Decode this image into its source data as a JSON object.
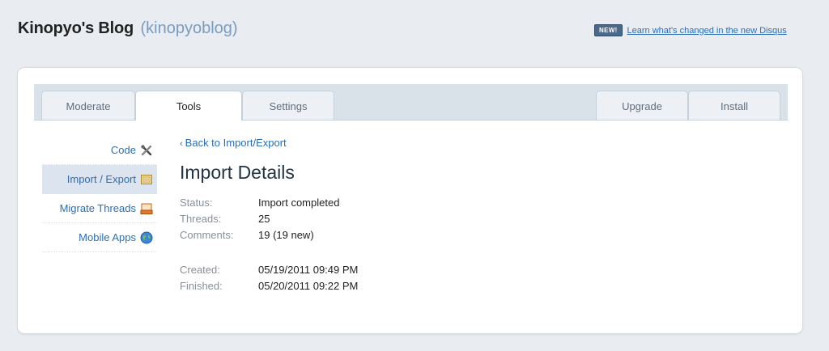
{
  "header": {
    "title": "Kinopyo's Blog",
    "handle": "(kinopyoblog)"
  },
  "news": {
    "badge": "NEW!",
    "link": "Learn what's changed in the new Disqus"
  },
  "tabs": [
    {
      "label": "Moderate"
    },
    {
      "label": "Tools"
    },
    {
      "label": "Settings"
    },
    {
      "label": "Upgrade"
    },
    {
      "label": "Install"
    }
  ],
  "sidebar": {
    "items": [
      {
        "label": "Code",
        "icon": "tools-icon"
      },
      {
        "label": "Import / Export",
        "icon": "import-export-icon"
      },
      {
        "label": "Migrate Threads",
        "icon": "inbox-icon"
      },
      {
        "label": "Mobile Apps",
        "icon": "globe-icon"
      }
    ]
  },
  "content": {
    "back_link": "Back to Import/Export",
    "back_chevron": "‹",
    "title": "Import Details",
    "status_label": "Status:",
    "status_value": "Import completed",
    "threads_label": "Threads:",
    "threads_value": "25",
    "comments_label": "Comments:",
    "comments_value": "19 (19 new)",
    "created_label": "Created:",
    "created_value": "05/19/2011 09:49 PM",
    "finished_label": "Finished:",
    "finished_value": "05/20/2011 09:22 PM"
  },
  "colors": {
    "link": "#2a6fb5",
    "active_side": "#dce5ef",
    "tabbar": "#d9e1e9",
    "page_bg": "#e9ecf0"
  }
}
